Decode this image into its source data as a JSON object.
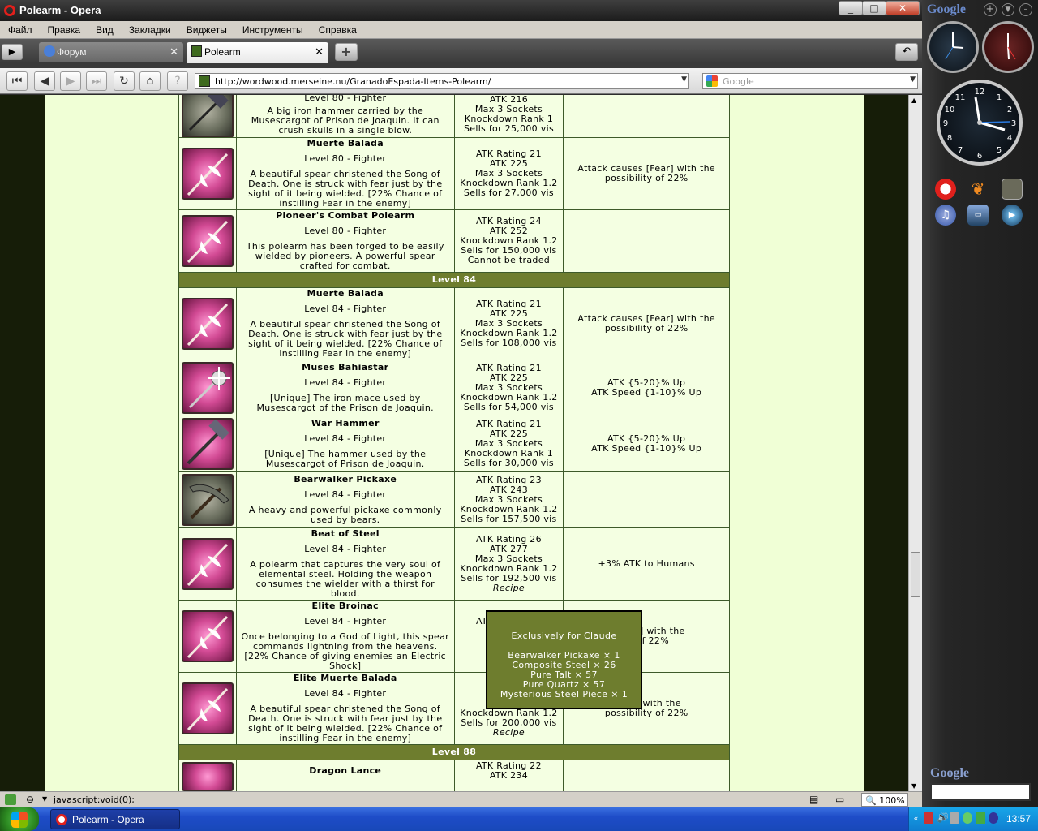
{
  "window": {
    "title": "Polearm - Opera"
  },
  "menu": [
    "Файл",
    "Правка",
    "Вид",
    "Закладки",
    "Виджеты",
    "Инструменты",
    "Справка"
  ],
  "tabs": [
    {
      "label": "Форум",
      "active": false
    },
    {
      "label": "Polearm",
      "active": true
    }
  ],
  "address": {
    "url": "http://wordwood.merseine.nu/GranadoEspada-Items-Polearm/"
  },
  "search": {
    "placeholder": "Google"
  },
  "top_row": {
    "name": "Level 80 - Fighter",
    "desc": "A big iron hammer carried by the Musescargot of Prison de Joaquin. It can crush skulls in a single blow.",
    "stats": [
      "ATK 216",
      "Max 3 Sockets",
      "Knockdown Rank 1",
      "Sells for 25,000 vis"
    ]
  },
  "rows_80": [
    {
      "name": "Muerte Balada",
      "level": "Level 80 - Fighter",
      "desc": "A beautiful spear christened the Song of Death. One is struck with fear just by the sight of it being wielded. [22% Chance of instilling Fear in the enemy]",
      "stats": [
        "ATK Rating 21",
        "ATK 225",
        "Max 3 Sockets",
        "Knockdown Rank 1.2",
        "Sells for 27,000 vis"
      ],
      "recipe": "",
      "effect": "Attack causes [Fear] with the possibility of 22%",
      "icon": "spear"
    },
    {
      "name": "Pioneer's Combat Polearm",
      "level": "Level 80 - Fighter",
      "desc": "This polearm has been forged to be easily wielded by pioneers. A powerful spear crafted for combat.",
      "stats": [
        "ATK Rating 24",
        "ATK 252",
        "Knockdown Rank 1.2",
        "Sells for 150,000 vis",
        "Cannot be traded"
      ],
      "recipe": "",
      "effect": "",
      "icon": "spear"
    }
  ],
  "level84_label": "Level 84",
  "rows_84": [
    {
      "name": "Muerte Balada",
      "level": "Level 84 - Fighter",
      "desc": "A beautiful spear christened the Song of Death. One is struck with fear just by the sight of it being wielded. [22% Chance of instilling Fear in the enemy]",
      "stats": [
        "ATK Rating 21",
        "ATK 225",
        "Max 3 Sockets",
        "Knockdown Rank 1.2",
        "Sells for 108,000 vis"
      ],
      "recipe": "",
      "effect": "Attack causes [Fear] with the possibility of 22%",
      "icon": "spear"
    },
    {
      "name": "Muses Bahiastar",
      "level": "Level 84 - Fighter",
      "desc": "[Unique] The iron mace used by Musescargot of the Prison de Joaquin.",
      "stats": [
        "ATK Rating 21",
        "ATK 225",
        "Max 3 Sockets",
        "Knockdown Rank 1.2",
        "Sells for 54,000 vis"
      ],
      "recipe": "",
      "effect": "ATK {5-20}% Up\nATK Speed {1-10}% Up",
      "icon": "mace"
    },
    {
      "name": "War Hammer",
      "level": "Level 84 - Fighter",
      "desc": "[Unique] The hammer used by the Musescargot of Prison de Joaquin.",
      "stats": [
        "ATK Rating 21",
        "ATK 225",
        "Max 3 Sockets",
        "Knockdown Rank 1",
        "Sells for 30,000 vis"
      ],
      "recipe": "",
      "effect": "ATK {5-20}% Up\nATK Speed {1-10}% Up",
      "icon": "hammer"
    },
    {
      "name": "Bearwalker Pickaxe",
      "level": "Level 84 - Fighter",
      "desc": "A heavy and powerful pickaxe commonly used by bears.",
      "stats": [
        "ATK Rating 23",
        "ATK 243",
        "Max 3 Sockets",
        "Knockdown Rank 1.2",
        "Sells for 157,500 vis"
      ],
      "recipe": "",
      "effect": "",
      "icon": "pickaxe"
    },
    {
      "name": "Beat of Steel",
      "level": "Level 84 - Fighter",
      "desc": "A polearm that captures the very soul of elemental steel. Holding the weapon consumes the wielder with a thirst for blood.",
      "stats": [
        "ATK Rating 26",
        "ATK 277",
        "Max 3 Sockets",
        "Knockdown Rank 1.2",
        "Sells for 192,500 vis"
      ],
      "recipe": "Recipe",
      "effect": "+3% ATK to Humans",
      "icon": "spear"
    },
    {
      "name": "Elite Broinac",
      "level": "Level 84 - Fighter",
      "desc": "Once belonging to a God of Light, this spear commands lightning from the heavens. [22% Chance of giving enemies an Electric Shock]",
      "stats": [
        "ATK Rating 26",
        "M",
        "Knoc",
        "Sells"
      ],
      "recipe": "",
      "effect": "[Shock] with the\nty of 22%",
      "icon": "spear"
    },
    {
      "name": "Elite Muerte Balada",
      "level": "Level 84 - Fighter",
      "desc": "A beautiful spear christened the Song of Death. One is struck with fear just by the sight of it being wielded. [22% Chance of instilling Fear in the enemy]",
      "stats": [
        "AT",
        "",
        "M",
        "Knockdown Rank 1.2",
        "Sells for 200,000 vis"
      ],
      "recipe": "Recipe",
      "effect": "[Fear] with the\npossibility of 22%",
      "icon": "spear"
    }
  ],
  "level88_label": "Level 88",
  "row_88": {
    "name": "Dragon Lance",
    "stats": [
      "ATK Rating 22",
      "ATK 234"
    ]
  },
  "tooltip": {
    "title": "Exclusively for Claude",
    "lines": [
      "Bearwalker Pickaxe × 1",
      "Composite Steel × 26",
      "Pure Talt × 57",
      "Pure Quartz × 57",
      "Mysterious Steel Piece × 1"
    ]
  },
  "status": {
    "text": "javascript:void(0);",
    "zoom": "100%"
  },
  "sidebar": {
    "google_top": "Google",
    "google_bottom": "Google"
  },
  "taskbar": {
    "task": "Polearm - Opera",
    "time": "13:57"
  },
  "colors": {
    "header_green": "#6e7d2e",
    "page_bg": "#f0ffd6",
    "opera_red": "#e0201c"
  }
}
